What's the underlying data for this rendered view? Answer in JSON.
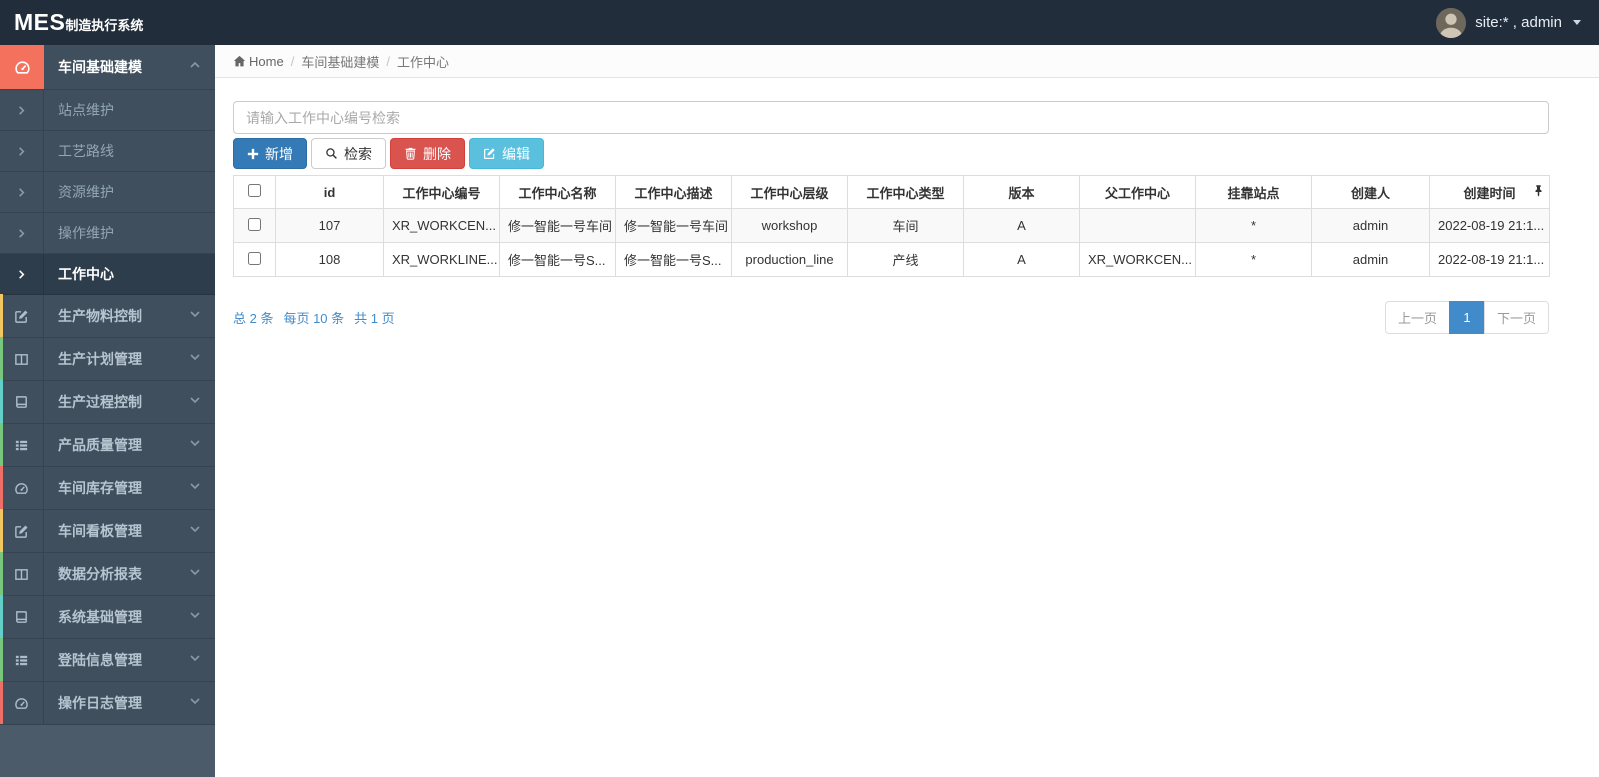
{
  "navbar": {
    "brand_primary": "MES",
    "brand_secondary": "制造执行系统",
    "user_label": "site:* , admin"
  },
  "sidebar": {
    "group": {
      "label": "车间基础建模",
      "icon": "gauge-icon",
      "icon_bg": "#f4715d"
    },
    "submenu": [
      "站点维护",
      "工艺路线",
      "资源维护",
      "操作维护",
      "工作中心"
    ],
    "active_submenu": "工作中心",
    "items": [
      {
        "label": "生产物料控制",
        "icon": "edit-square-icon",
        "accent": "#f2c661"
      },
      {
        "label": "生产计划管理",
        "icon": "columns-icon",
        "accent": "#79c77f"
      },
      {
        "label": "生产过程控制",
        "icon": "book-icon",
        "accent": "#63cfc9"
      },
      {
        "label": "产品质量管理",
        "icon": "list-icon",
        "accent": "#79c77f"
      },
      {
        "label": "车间库存管理",
        "icon": "gauge-icon",
        "accent": "#ef6f66"
      },
      {
        "label": "车间看板管理",
        "icon": "edit-square-icon",
        "accent": "#f2c661"
      },
      {
        "label": "数据分析报表",
        "icon": "columns-icon",
        "accent": "#79c77f"
      },
      {
        "label": "系统基础管理",
        "icon": "book-icon",
        "accent": "#63cfc9"
      },
      {
        "label": "登陆信息管理",
        "icon": "list-icon",
        "accent": "#79c77f"
      },
      {
        "label": "操作日志管理",
        "icon": "gauge-icon",
        "accent": "#ef6f66"
      }
    ]
  },
  "breadcrumb": {
    "home": "Home",
    "sep": "/",
    "items": [
      "车间基础建模",
      "工作中心"
    ]
  },
  "search": {
    "placeholder": "请输入工作中心编号检索"
  },
  "toolbar": {
    "add": "新增",
    "search": "检索",
    "delete": "删除",
    "edit": "编辑"
  },
  "table": {
    "columns": [
      "id",
      "工作中心编号",
      "工作中心名称",
      "工作中心描述",
      "工作中心层级",
      "工作中心类型",
      "版本",
      "父工作中心",
      "挂靠站点",
      "创建人",
      "创建时间"
    ],
    "rows": [
      [
        "107",
        "XR_WORKCEN...",
        "修一智能一号车间",
        "修一智能一号车间",
        "workshop",
        "车间",
        "A",
        "",
        "*",
        "admin",
        "2022-08-19 21:1..."
      ],
      [
        "108",
        "XR_WORKLINE...",
        "修一智能一号S...",
        "修一智能一号S...",
        "production_line",
        "产线",
        "A",
        "XR_WORKCEN...",
        "*",
        "admin",
        "2022-08-19 21:1..."
      ]
    ]
  },
  "pagination": {
    "summary_total": "总 2 条",
    "summary_per_page": "每页 10 条",
    "summary_pages": "共 1 页",
    "prev": "上一页",
    "page": "1",
    "next": "下一页"
  },
  "colors": {
    "navbar_bg": "#222d3b",
    "sidebar_bg": "#4c5b69",
    "sidebar_item_bg": "#3f4f5e",
    "active_icon_bg": "#f4715d",
    "primary": "#337ab7",
    "danger": "#d9534f",
    "info": "#5bc0de",
    "link_blue": "#428bca"
  }
}
